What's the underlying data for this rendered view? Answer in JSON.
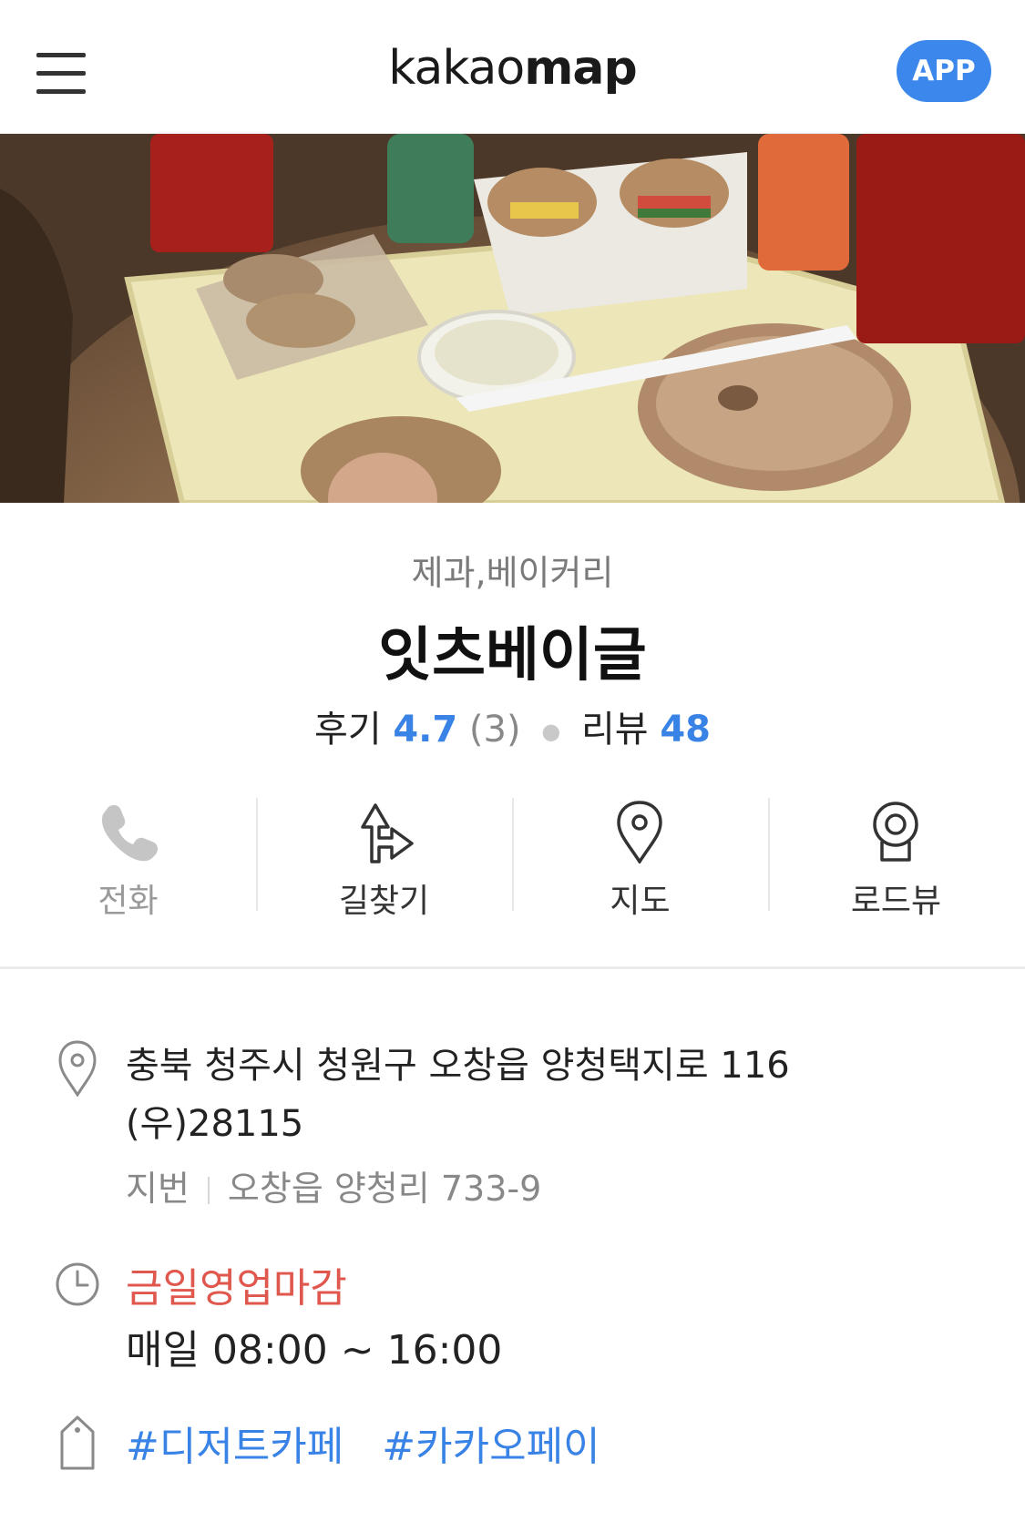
{
  "header": {
    "logo_regular": "kakao",
    "logo_bold": "map",
    "app_button": "APP"
  },
  "place": {
    "category": "제과,베이커리",
    "name": "잇츠베이글",
    "review_label": "후기",
    "review_score": "4.7",
    "review_count": "(3)",
    "blog_review_label": "리뷰",
    "blog_review_count": "48"
  },
  "actions": [
    {
      "label": "전화",
      "icon": "phone-icon",
      "enabled": false
    },
    {
      "label": "길찾기",
      "icon": "directions-icon",
      "enabled": true
    },
    {
      "label": "지도",
      "icon": "map-pin-icon",
      "enabled": true
    },
    {
      "label": "로드뷰",
      "icon": "roadview-icon",
      "enabled": true
    }
  ],
  "info": {
    "address_line1": "충북 청주시 청원구 오창읍 양청택지로 116",
    "address_line2": "(우)28115",
    "jibun_label": "지번",
    "jibun_address": "오창읍 양청리 733-9",
    "status": "금일영업마감",
    "hours": "매일 08:00 ~ 16:00",
    "tags": [
      "#디저트카페",
      "#카카오페이"
    ]
  },
  "colors": {
    "accent_blue": "#3a83e6",
    "app_button_blue": "#3c87eb",
    "closed_red": "#e0574e"
  }
}
